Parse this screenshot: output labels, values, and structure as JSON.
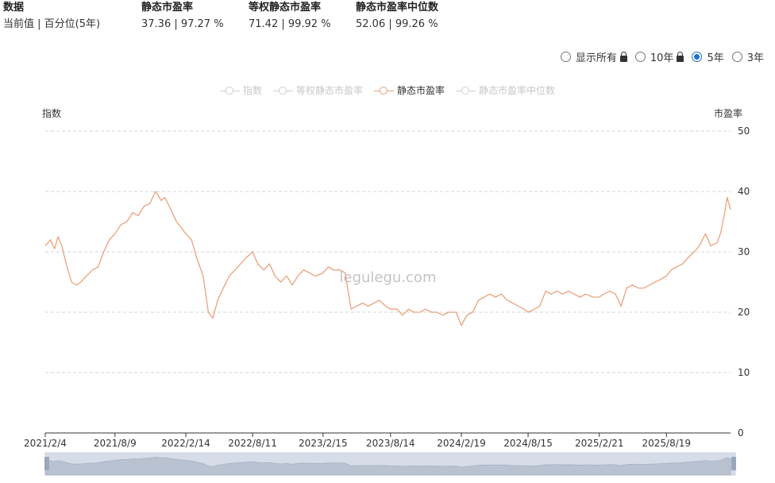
{
  "stats": [
    {
      "head": "数据",
      "val": "当前值 | 百分位(5年)"
    },
    {
      "head": "静态市盈率",
      "val": "37.36 | 97.27 %"
    },
    {
      "head": "等权静态市盈率",
      "val": "71.42 | 99.92 %"
    },
    {
      "head": "静态市盈率中位数",
      "val": "52.06 | 99.26 %"
    }
  ],
  "range_options": [
    {
      "label": "显示所有",
      "locked": true,
      "selected": false
    },
    {
      "label": "10年",
      "locked": true,
      "selected": false
    },
    {
      "label": "5年",
      "locked": false,
      "selected": true
    },
    {
      "label": "3年",
      "locked": false,
      "selected": false
    }
  ],
  "legend": [
    {
      "label": "指数",
      "active": false
    },
    {
      "label": "等权静态市盈率",
      "active": false
    },
    {
      "label": "静态市盈率",
      "active": true
    },
    {
      "label": "静态市盈率中位数",
      "active": false
    }
  ],
  "colors": {
    "series": "#eba27c",
    "grid": "#d4d4d4",
    "axis": "#333333",
    "zoom_bg": "#d6dde8",
    "radio_on": "#1a73c8"
  },
  "chart_data": {
    "type": "line",
    "left_axis_label": "指数",
    "right_axis_label": "市盈率",
    "watermark": "legulegu.com",
    "ylim": [
      0,
      50
    ],
    "yticks": [
      0,
      10,
      20,
      30,
      40,
      50
    ],
    "xlim": [
      "2021-02-04",
      "2026-02-06"
    ],
    "xticks": [
      "2021/2/4",
      "2021/8/9",
      "2022/2/14",
      "2022/8/11",
      "2023/2/15",
      "2023/8/14",
      "2024/2/19",
      "2024/8/15",
      "2025/2/21",
      "2025/8/19"
    ],
    "grid": true,
    "legend_position": "top-center",
    "series": [
      {
        "name": "静态市盈率",
        "x": [
          "2021-02-04",
          "2021-02-18",
          "2021-03-01",
          "2021-03-10",
          "2021-03-20",
          "2021-04-01",
          "2021-04-15",
          "2021-04-28",
          "2021-05-10",
          "2021-05-25",
          "2021-06-10",
          "2021-06-25",
          "2021-07-10",
          "2021-07-25",
          "2021-08-09",
          "2021-08-25",
          "2021-09-10",
          "2021-09-25",
          "2021-10-10",
          "2021-10-25",
          "2021-11-10",
          "2021-11-25",
          "2021-12-10",
          "2021-12-20",
          "2022-01-05",
          "2022-01-20",
          "2022-02-14",
          "2022-03-01",
          "2022-03-15",
          "2022-04-01",
          "2022-04-15",
          "2022-04-27",
          "2022-05-10",
          "2022-05-25",
          "2022-06-10",
          "2022-06-25",
          "2022-07-10",
          "2022-07-25",
          "2022-08-11",
          "2022-08-25",
          "2022-09-10",
          "2022-09-25",
          "2022-10-10",
          "2022-10-25",
          "2022-11-10",
          "2022-11-25",
          "2022-12-10",
          "2022-12-25",
          "2023-01-10",
          "2023-01-25",
          "2023-02-15",
          "2023-03-01",
          "2023-03-15",
          "2023-03-20",
          "2023-04-01",
          "2023-04-15",
          "2023-05-01",
          "2023-05-15",
          "2023-06-01",
          "2023-06-15",
          "2023-07-01",
          "2023-07-15",
          "2023-08-01",
          "2023-08-14",
          "2023-09-01",
          "2023-09-15",
          "2023-10-01",
          "2023-10-15",
          "2023-11-01",
          "2023-11-15",
          "2023-12-01",
          "2023-12-15",
          "2024-01-01",
          "2024-01-15",
          "2024-02-05",
          "2024-02-19",
          "2024-03-05",
          "2024-03-20",
          "2024-04-05",
          "2024-04-20",
          "2024-05-05",
          "2024-05-20",
          "2024-06-05",
          "2024-06-20",
          "2024-07-05",
          "2024-07-20",
          "2024-08-05",
          "2024-08-15",
          "2024-09-01",
          "2024-09-15",
          "2024-10-01",
          "2024-10-15",
          "2024-11-01",
          "2024-11-15",
          "2024-12-01",
          "2024-12-15",
          "2025-01-01",
          "2025-01-15",
          "2025-02-05",
          "2025-02-21",
          "2025-03-05",
          "2025-03-20",
          "2025-04-05",
          "2025-04-20",
          "2025-05-05",
          "2025-05-20",
          "2025-06-05",
          "2025-06-20",
          "2025-07-05",
          "2025-07-20",
          "2025-08-05",
          "2025-08-19",
          "2025-09-01",
          "2025-09-15",
          "2025-10-01",
          "2025-10-15",
          "2025-11-01",
          "2025-11-15",
          "2025-12-01",
          "2025-12-15",
          "2026-01-01",
          "2026-01-10",
          "2026-01-20",
          "2026-01-28",
          "2026-02-06"
        ],
        "values": [
          31,
          32,
          30.5,
          32.5,
          31,
          28,
          25,
          24.5,
          25,
          26,
          27,
          27.5,
          30,
          32,
          33,
          34.5,
          35,
          36.5,
          36,
          37.5,
          38,
          40,
          38.5,
          39,
          37,
          35,
          33,
          32,
          29,
          26,
          20,
          19,
          22,
          24,
          26,
          27,
          28,
          29,
          30,
          28,
          27,
          28,
          26,
          25,
          26,
          24.5,
          26,
          27,
          26.5,
          26,
          26.5,
          27.5,
          27,
          27,
          27,
          26.5,
          20.5,
          21,
          21.5,
          21,
          21.5,
          22,
          21,
          20.5,
          20.5,
          19.5,
          20.5,
          20,
          20,
          20.5,
          20,
          20,
          19.5,
          20,
          20,
          17.8,
          19.5,
          20,
          22,
          22.5,
          23,
          22.5,
          23,
          22,
          21.5,
          21,
          20.5,
          20,
          20.5,
          21,
          23.5,
          23,
          23.5,
          23,
          23.5,
          23,
          22.5,
          23,
          22.5,
          22.5,
          23,
          23.5,
          23,
          21,
          24,
          24.5,
          24,
          24,
          24.5,
          25,
          25.5,
          26,
          27,
          27.5,
          28,
          29,
          30,
          31,
          33,
          31,
          31.5,
          33,
          36,
          39,
          37
        ]
      }
    ]
  },
  "zoom": {
    "start": 0,
    "end": 1
  }
}
